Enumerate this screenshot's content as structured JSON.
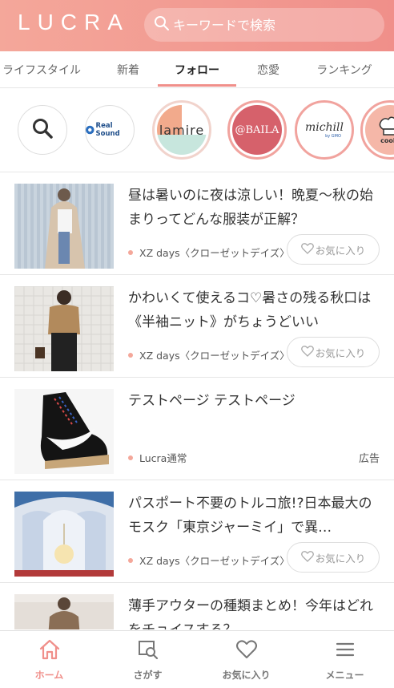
{
  "header": {
    "logo": "LUCRA",
    "search_placeholder": "キーワードで検索"
  },
  "tabs": [
    {
      "label": "ライフスタイル",
      "active": false
    },
    {
      "label": "新着",
      "active": false
    },
    {
      "label": "フォロー",
      "active": true
    },
    {
      "label": "恋愛",
      "active": false
    },
    {
      "label": "ランキング",
      "active": false
    }
  ],
  "media": [
    {
      "name": "search-icon"
    },
    {
      "label": "Real Sound"
    },
    {
      "label": "lamire"
    },
    {
      "label": "@BAILA"
    },
    {
      "label": "michill",
      "sub": "by GMO"
    },
    {
      "label": "cooki"
    }
  ],
  "articles": [
    {
      "title": "昼は暑いのに夜は涼しい！晩夏〜秋の始まりってどんな服装が正解？",
      "source": "XZ days〈クローゼットデイズ〉",
      "fav_label": "お気に入り"
    },
    {
      "title": "かわいくて使えるコ♡暑さの残る秋口は《半袖ニット》がちょうどいい",
      "source": "XZ days〈クローゼットデイズ〉",
      "fav_label": "お気に入り"
    },
    {
      "title": "テストページ テストページ",
      "source": "Lucra通常",
      "ad_label": "広告"
    },
    {
      "title": "パスポート不要のトルコ旅!?日本最大のモスク「東京ジャーミイ」で異…",
      "source": "XZ days〈クローゼットデイズ〉",
      "fav_label": "お気に入り"
    },
    {
      "title": "薄手アウターの種類まとめ！今年はどれをチョイスする？"
    }
  ],
  "bottom_nav": [
    {
      "label": "ホーム",
      "icon": "home-icon",
      "active": true
    },
    {
      "label": "さがす",
      "icon": "search-icon",
      "active": false
    },
    {
      "label": "お気に入り",
      "icon": "heart-icon",
      "active": false
    },
    {
      "label": "メニュー",
      "icon": "menu-icon",
      "active": false
    }
  ],
  "colors": {
    "brand": "#f08f8a",
    "header_start": "#f4a79a",
    "dot": "#f4a79a"
  }
}
